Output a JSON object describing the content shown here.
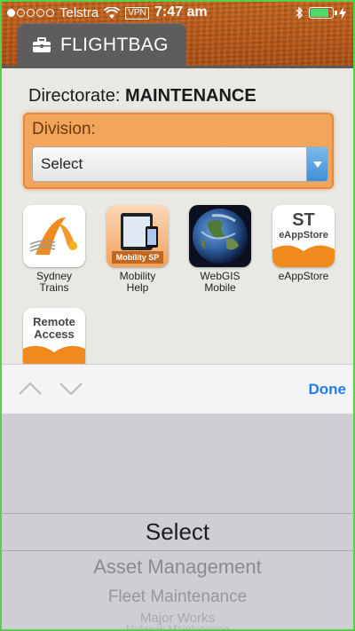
{
  "status_bar": {
    "carrier": "Telstra",
    "vpn": "VPN",
    "time": "7:47 am",
    "battery_level": 0.85
  },
  "header": {
    "tab_label": "FLIGHTBAG",
    "tab_icon": "briefcase-icon"
  },
  "main": {
    "directorate_label": "Directorate:",
    "directorate_value": "MAINTENANCE",
    "division_label": "Division:",
    "division_select_value": "Select"
  },
  "apps": [
    {
      "name": "Sydney Trains",
      "line1": "Sydney",
      "line2": "Trains"
    },
    {
      "name": "Mobility Help",
      "line1": "Mobility",
      "line2": "Help",
      "badge": "Mobility SP"
    },
    {
      "name": "WebGIS Mobile",
      "line1": "WebGIS",
      "line2": "Mobile"
    },
    {
      "name": "eAppStore",
      "line1": "eAppStore",
      "line2": "",
      "icon_top": "ST",
      "icon_sub": "eAppStore"
    },
    {
      "name": "Remote Access",
      "icon_line1": "Remote",
      "icon_line2": "Access"
    }
  ],
  "accessory_bar": {
    "done_label": "Done"
  },
  "picker": {
    "options": [
      "Select",
      "Asset Management",
      "Fleet Maintenance",
      "Major Works",
      "Network Maintenance"
    ],
    "selected": "Select"
  },
  "colors": {
    "accent_orange": "#f1a65c",
    "done_blue": "#1c7ef4",
    "tab_gray": "#5d5d5d",
    "battery_green": "#4cd964"
  }
}
